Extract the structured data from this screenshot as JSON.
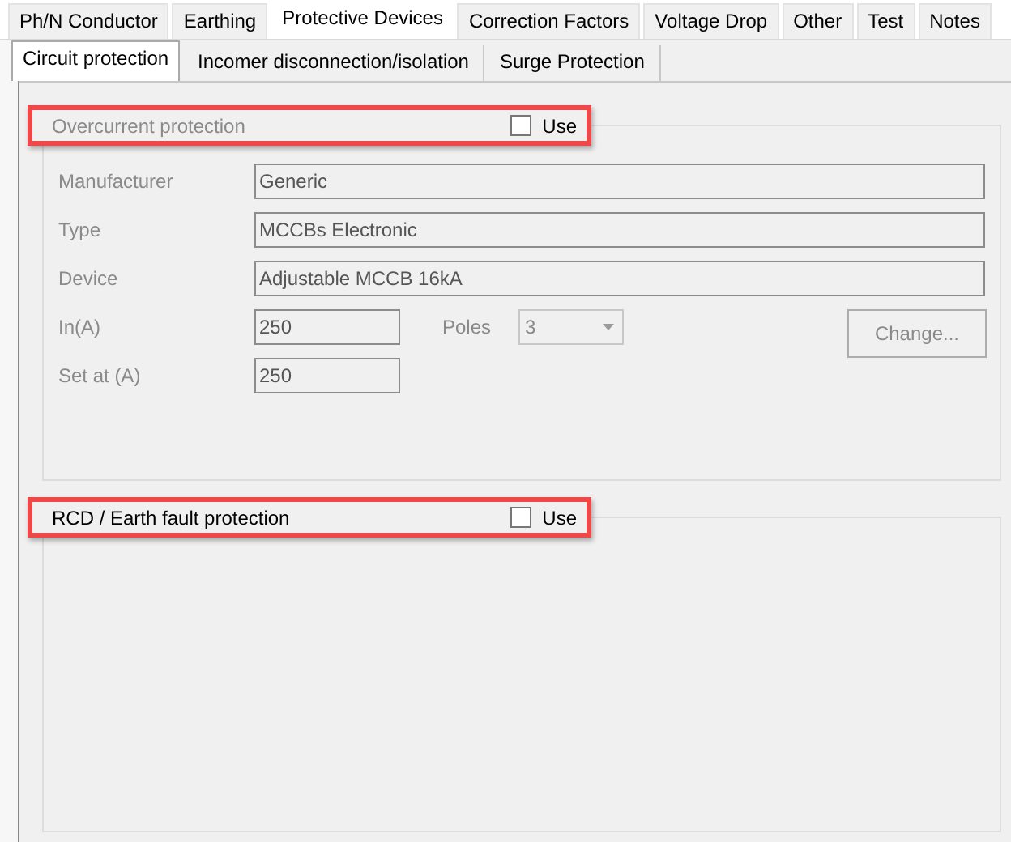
{
  "tabs": [
    {
      "label": "Ph/N Conductor",
      "selected": false
    },
    {
      "label": "Earthing",
      "selected": false
    },
    {
      "label": "Protective Devices",
      "selected": true
    },
    {
      "label": "Correction Factors",
      "selected": false
    },
    {
      "label": "Voltage Drop",
      "selected": false
    },
    {
      "label": "Other",
      "selected": false
    },
    {
      "label": "Test",
      "selected": false
    },
    {
      "label": "Notes",
      "selected": false
    }
  ],
  "subtabs": [
    {
      "label": "Circuit protection",
      "selected": true
    },
    {
      "label": "Incomer disconnection/isolation",
      "selected": false
    },
    {
      "label": "Surge Protection",
      "selected": false
    }
  ],
  "overcurrent": {
    "title": "Overcurrent protection",
    "use_label": "Use",
    "use_checked": false,
    "disabled": true,
    "highlighted": true,
    "fields": [
      {
        "label": "Manufacturer",
        "value": "Generic"
      },
      {
        "label": "Type",
        "value": "MCCBs Electronic"
      },
      {
        "label": "Device",
        "value": "Adjustable MCCB 16kA"
      }
    ],
    "in": {
      "label": "In(A)",
      "value": "250"
    },
    "poles": {
      "label": "Poles",
      "value": "3"
    },
    "change_button": "Change...",
    "set_at": {
      "label": "Set at (A)",
      "value": "250"
    }
  },
  "rcd": {
    "title": "RCD / Earth fault protection",
    "use_label": "Use",
    "use_checked": false,
    "disabled": false,
    "highlighted": true
  }
}
